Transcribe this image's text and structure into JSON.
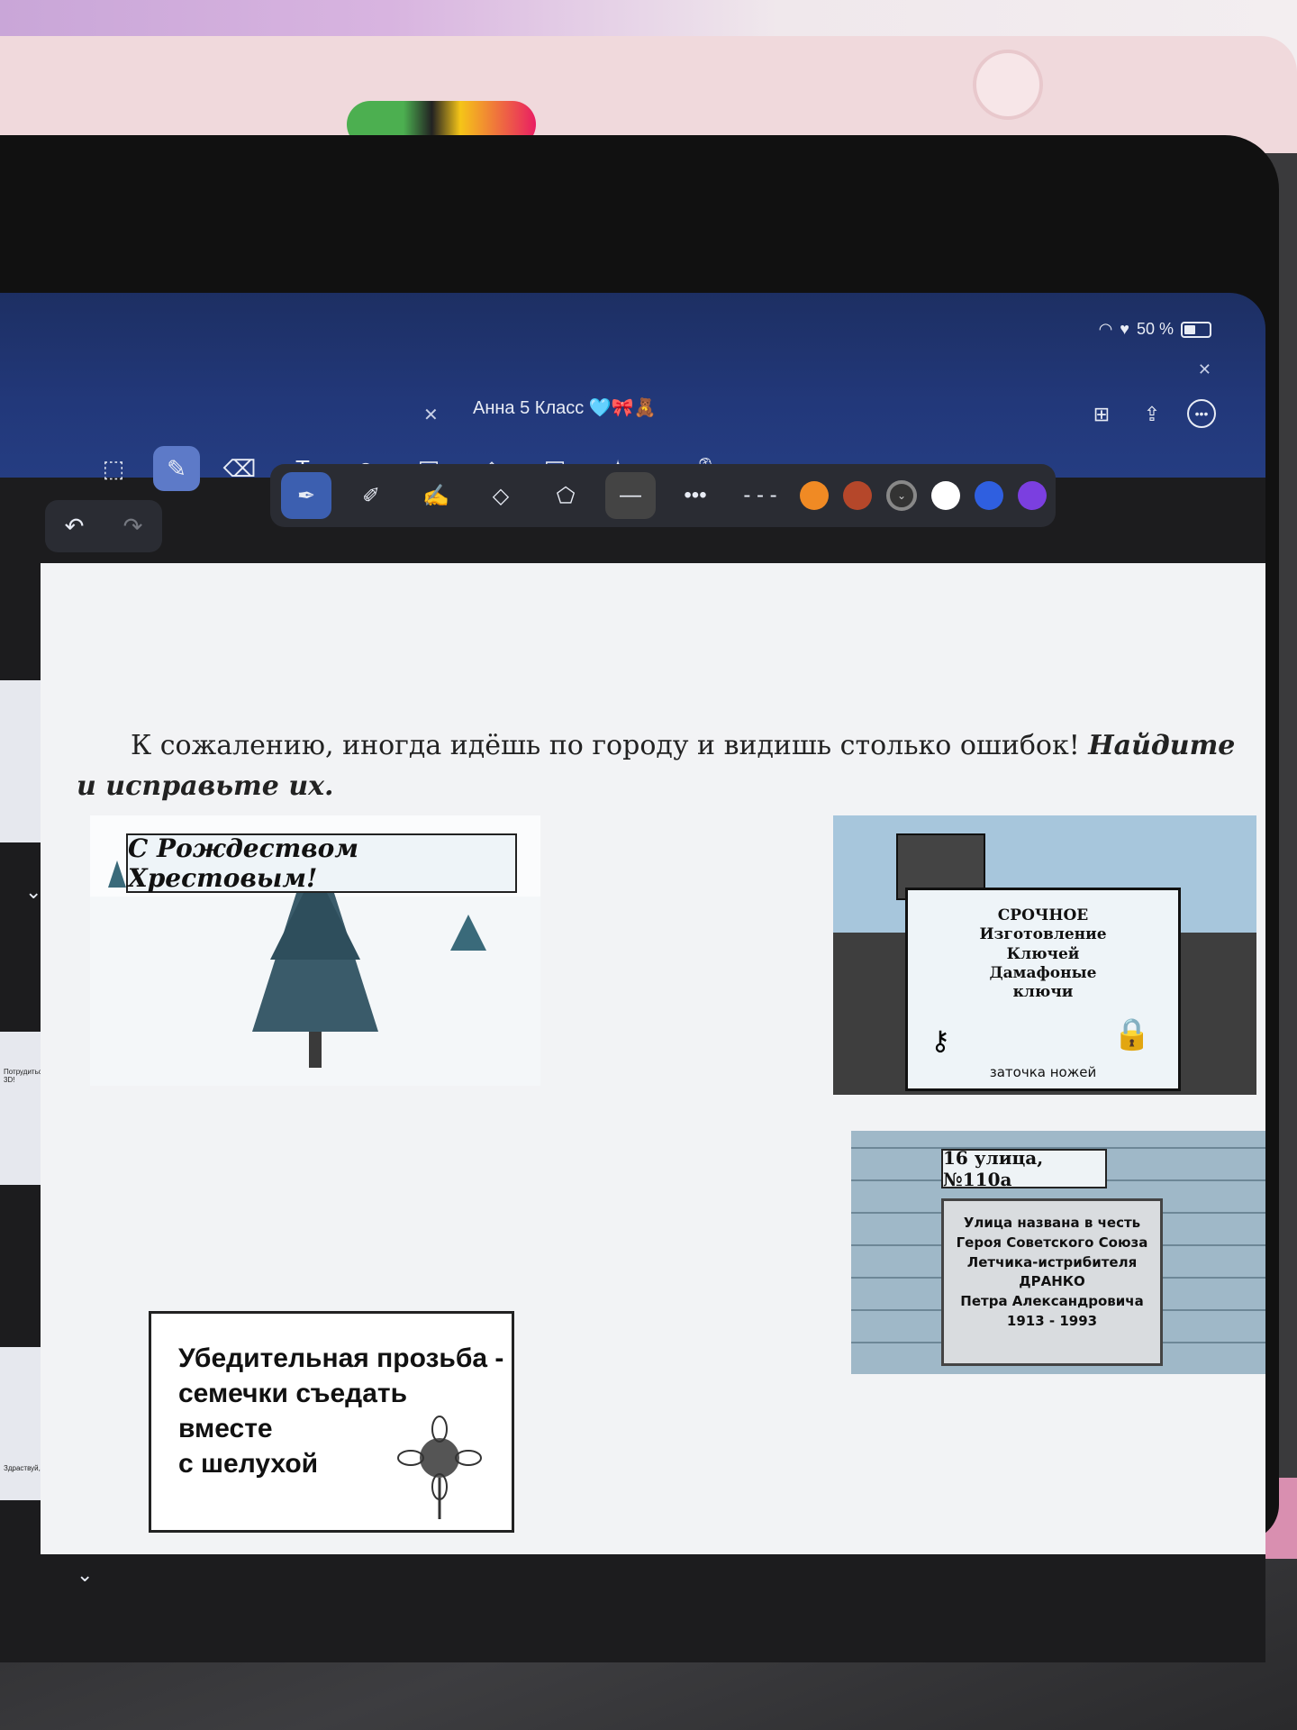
{
  "status": {
    "battery": "50 %"
  },
  "tab": {
    "title": "Анна 5 Класс 🩵🎀🧸"
  },
  "toolbar": {
    "tools": [
      "select-lasso",
      "pen",
      "eraser",
      "text",
      "sticker",
      "image",
      "shapes",
      "sticky-note",
      "laser"
    ],
    "active_tool": "pen"
  },
  "pen_options": {
    "colors": [
      "#f08a24",
      "#b5472a",
      "#333333",
      "#ffffff",
      "#2f5fe0",
      "#7b3fe0"
    ]
  },
  "content": {
    "lead_text": "К сожалению, иногда идёшь по городу  и видишь столько ошибок!",
    "lead_task_1": "Найдите",
    "lead_task_2": "и исправьте их.",
    "xmas_banner": "С Рождеством Хрестовым!",
    "keys_sign": {
      "line1": "СРОЧНОЕ",
      "line2": "Изготовление",
      "line3": "Ключей",
      "line4": "Дамафоные",
      "line5": "ключи",
      "footer": "заточка ножей"
    },
    "street_sign": {
      "header": "16 улица, №110а",
      "line1": "Улица названа в честь",
      "line2": "Героя Советского Союза",
      "line3": "Летчика-истрибителя",
      "line4": "ДРАНКО",
      "line5": "Петра Александровича",
      "line6": "1913 - 1993"
    },
    "seeds_sign": {
      "line1": "Убедительная прозьба -",
      "line2": "семечки съедать",
      "line3": "вместе",
      "line4": "с шелухой"
    }
  },
  "sidebar": {
    "thumb2_caption": "Потрудиться в 3D!",
    "thumb3_caption": "Здраствуй, школа!"
  }
}
